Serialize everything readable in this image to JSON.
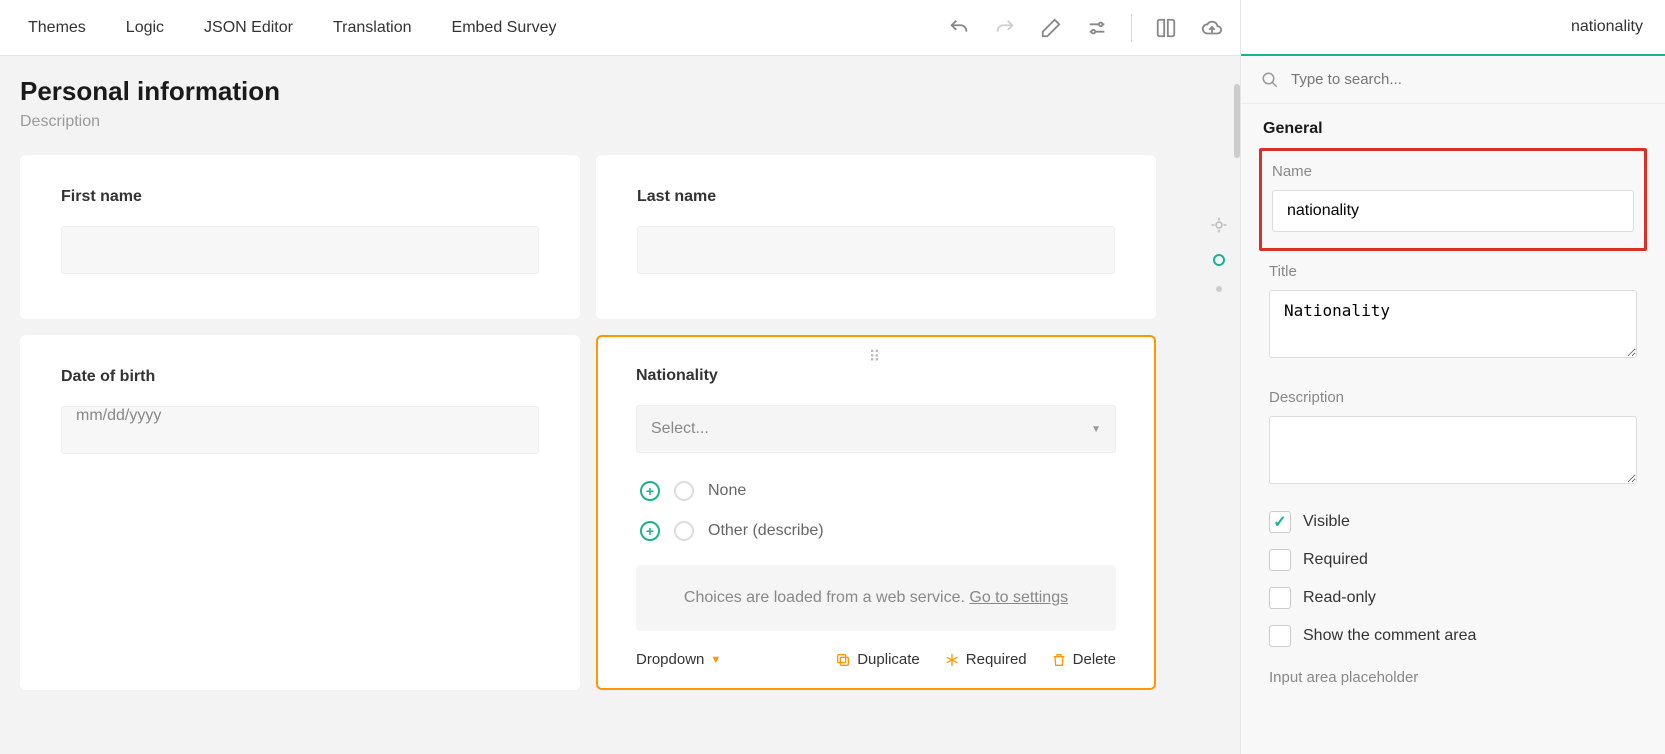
{
  "toolbar": {
    "tabs": [
      "Themes",
      "Logic",
      "JSON Editor",
      "Translation",
      "Embed Survey"
    ]
  },
  "page": {
    "title": "Personal information",
    "description": "Description"
  },
  "questions": {
    "first_name": {
      "label": "First name"
    },
    "last_name": {
      "label": "Last name"
    },
    "dob": {
      "label": "Date of birth",
      "placeholder": "mm/dd/yyyy"
    },
    "nationality": {
      "label": "Nationality",
      "select_placeholder": "Select...",
      "choice_none": "None",
      "choice_other": "Other (describe)",
      "info_text": "Choices are loaded from a web service. ",
      "info_link": "Go to settings",
      "type_label": "Dropdown",
      "action_duplicate": "Duplicate",
      "action_required": "Required",
      "action_delete": "Delete"
    }
  },
  "panel": {
    "header": "nationality",
    "search_placeholder": "Type to search...",
    "section_general": "General",
    "name_label": "Name",
    "name_value": "nationality",
    "title_label": "Title",
    "title_value": "Nationality",
    "desc_label": "Description",
    "desc_value": "",
    "visible_label": "Visible",
    "required_label": "Required",
    "readonly_label": "Read-only",
    "comment_label": "Show the comment area",
    "placeholder_label": "Input area placeholder"
  }
}
